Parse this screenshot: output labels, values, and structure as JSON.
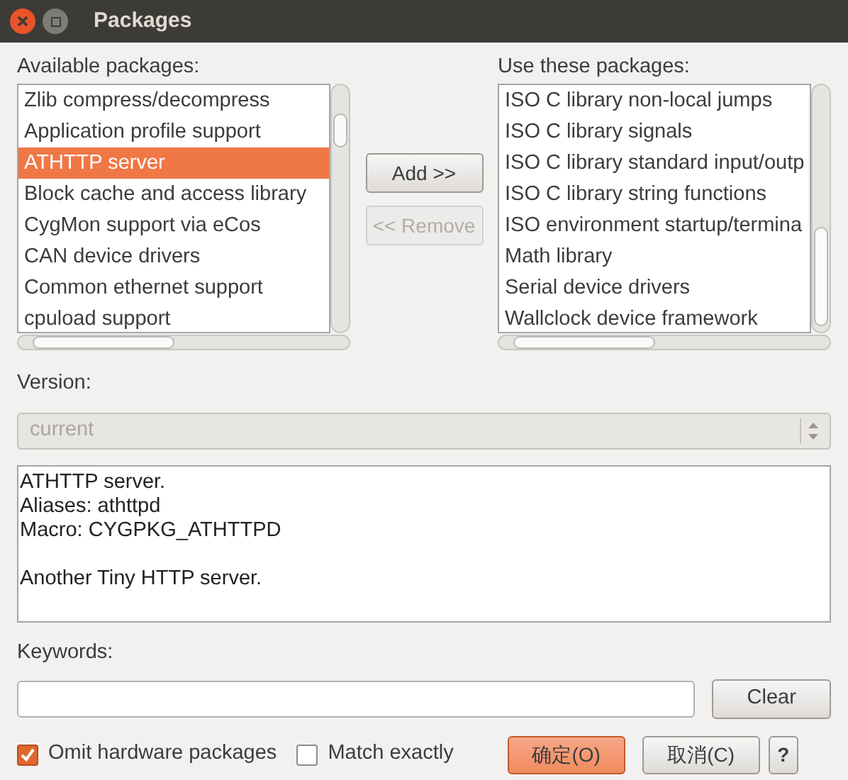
{
  "window": {
    "title": "Packages"
  },
  "available_packages": {
    "label": "Available packages:",
    "items": [
      {
        "label": "Zlib compress/decompress",
        "selected": false
      },
      {
        "label": "Application profile support",
        "selected": false
      },
      {
        "label": "ATHTTP server",
        "selected": true
      },
      {
        "label": "Block cache and access library",
        "selected": false
      },
      {
        "label": "CygMon support via eCos",
        "selected": false
      },
      {
        "label": "CAN device drivers",
        "selected": false
      },
      {
        "label": "Common ethernet support",
        "selected": false
      },
      {
        "label": "cpuload support",
        "selected": false
      }
    ]
  },
  "transfer_buttons": [
    {
      "label": "Add >>",
      "disabled": false
    },
    {
      "label": "<< Remove",
      "disabled": true
    }
  ],
  "used_packages": {
    "label": "Use these packages:",
    "items": [
      {
        "label": "ISO C library non-local jumps",
        "selected": false
      },
      {
        "label": "ISO C library signals",
        "selected": false
      },
      {
        "label": "ISO C library standard input/outp",
        "selected": false
      },
      {
        "label": "ISO C library string functions",
        "selected": false
      },
      {
        "label": "ISO environment startup/termina",
        "selected": false
      },
      {
        "label": "Math library",
        "selected": false
      },
      {
        "label": "Serial device drivers",
        "selected": false
      },
      {
        "label": "Wallclock device framework",
        "selected": false
      }
    ]
  },
  "version": {
    "label": "Version:",
    "value": "current",
    "disabled": true
  },
  "description": [
    "ATHTTP server.\nAliases: athttpd\nMacro: CYGPKG_ATHTTPD",
    "Another Tiny HTTP server."
  ],
  "keywords": {
    "label": "Keywords:",
    "clear_button": "Clear"
  },
  "options": [
    {
      "label": "Omit hardware packages",
      "checked": true
    },
    {
      "label": "Match exactly",
      "checked": false
    }
  ],
  "dialog_buttons": [
    {
      "label": "确定(O)",
      "kind": "default"
    },
    {
      "label": "取消(C)",
      "kind": "normal"
    },
    {
      "label": "?",
      "kind": "help"
    }
  ]
}
